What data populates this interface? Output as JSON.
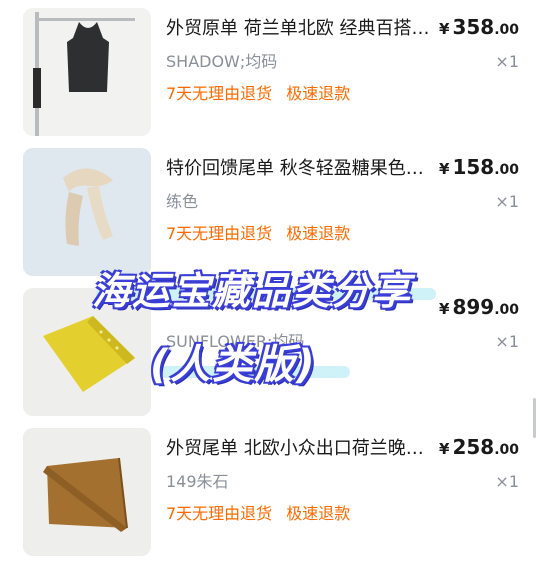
{
  "items": [
    {
      "title": "外贸原单 荷兰单北欧 经典百搭羊毛背心",
      "price_currency": "¥",
      "price_int": "358",
      "price_dec": ".00",
      "spec": "SHADOW;均码",
      "qty": "×1",
      "service_1": "7天无理由退货",
      "service_2": "极速退款"
    },
    {
      "title": "特价回馈尾单 秋冬轻盈糖果色围巾",
      "price_currency": "¥",
      "price_int": "158",
      "price_dec": ".00",
      "spec": "练色",
      "qty": "×1",
      "service_1": "7天无理由退货",
      "service_2": "极速退款"
    },
    {
      "title": "",
      "price_currency": "¥",
      "price_int": "899",
      "price_dec": ".00",
      "spec": "SUNFLOWER;均码",
      "qty": "×1",
      "service_1": "",
      "service_2": ""
    },
    {
      "title": "外贸尾单 北欧小众出口荷兰晚装披肩",
      "price_currency": "¥",
      "price_int": "258",
      "price_dec": ".00",
      "spec": "149朱石",
      "qty": "×1",
      "service_1": "7天无理由退货",
      "service_2": "极速退款"
    }
  ],
  "overlay": {
    "line_1": "海运宝藏品类分享",
    "line_2": "(人类版)"
  },
  "colors": {
    "service": "#ff6a00",
    "overlay_outline": "#3b3fd6",
    "overlay_stripe": "#c7eef7"
  },
  "icons": [
    "vest-product-image",
    "scarf-product-image",
    "cardigan-product-image",
    "shawl-product-image"
  ]
}
